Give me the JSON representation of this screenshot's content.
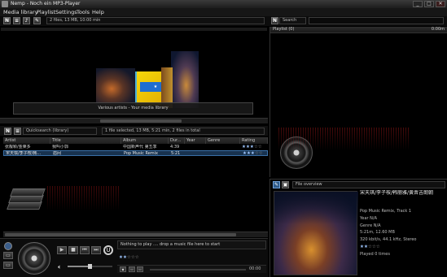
{
  "window": {
    "title": "Nemp - Noch ein MP3-Player",
    "controls": [
      "_",
      "□",
      "✕"
    ]
  },
  "menu": [
    "Media library",
    "Playlist",
    "Settings",
    "Tools",
    "Help"
  ],
  "toolbar": {
    "search_label": "Search",
    "summary": "2 files, 13 MB, 10:00 min"
  },
  "coverflow": {
    "caption": "Various artists - Your media library"
  },
  "quicksearch": {
    "label": "Quicksearch (library)",
    "status": "1 file selected, 13 MB, 5:21 min, 2 files in total"
  },
  "table": {
    "columns": [
      "Artist",
      "Title",
      "Album",
      "Dur...",
      "Year",
      "Genre",
      "Rating"
    ],
    "rows": [
      {
        "artist": "张靓颖/金莱多",
        "title": "我叫小郭",
        "album": "中国新声代 第五季",
        "duration": "4:39",
        "year": "",
        "genre": "",
        "rating": 3,
        "selected": false
      },
      {
        "artist": "宋天琪/李子桉/韩...",
        "title": "眉间",
        "album": "Pop Music Remix",
        "duration": "5:21",
        "year": "",
        "genre": "",
        "rating": 3,
        "selected": true
      }
    ]
  },
  "playlist": {
    "header": "Playlist (0)",
    "duration": "0:00m"
  },
  "player": {
    "now_playing": "Nothing to play .... drop a music file here to start",
    "time": "00:00",
    "rating": 2
  },
  "file_overview": {
    "label": "File overview",
    "artist": "宋天琪/李子桉/韩丽雅/黄晋吉朗朝",
    "album_track": "Pop Music Remix, Track 1",
    "year": "Year N/A",
    "genre": "Genre N/A",
    "length_size": "5:21m, 12.60 MB",
    "bitrate": "320 kbit/s, 44.1 kHz, Stereo",
    "rating": 2,
    "played": "Played 0 times"
  }
}
